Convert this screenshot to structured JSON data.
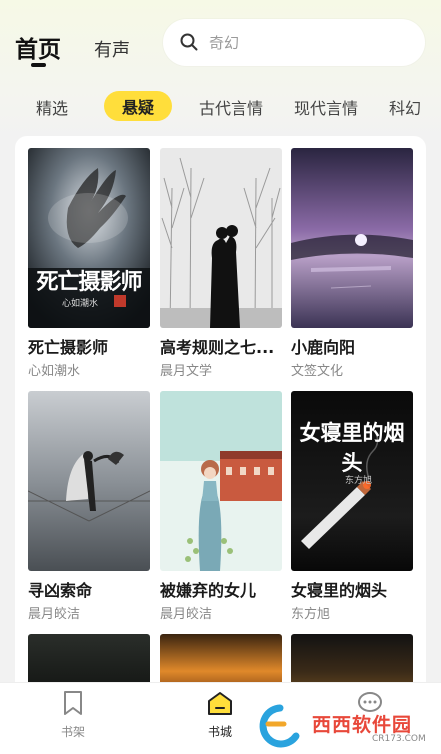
{
  "header": {
    "tabs": [
      {
        "label": "首页"
      },
      {
        "label": "有声"
      }
    ],
    "search": {
      "placeholder": "奇幻"
    }
  },
  "categories": [
    {
      "label": "精选"
    },
    {
      "label": "悬疑"
    },
    {
      "label": "古代言情"
    },
    {
      "label": "现代言情"
    },
    {
      "label": "科幻"
    }
  ],
  "books": [
    {
      "title": "死亡摄影师",
      "author": "心如潮水",
      "cover_title": "死亡摄影师",
      "cover_author": "心如潮水"
    },
    {
      "title": "高考规则之七...",
      "author": "晨月文学"
    },
    {
      "title": "小鹿向阳",
      "author": "文签文化"
    },
    {
      "title": "寻凶索命",
      "author": "晨月皎洁"
    },
    {
      "title": "被嫌弃的女儿",
      "author": "晨月皎洁"
    },
    {
      "title": "女寝里的烟头",
      "author": "东方旭",
      "cover_title": "女寝里的烟头",
      "cover_author": "东方旭"
    }
  ],
  "bottom_nav": [
    {
      "label": "书架",
      "icon": "bookmark-icon"
    },
    {
      "label": "书城",
      "icon": "home-icon"
    }
  ],
  "watermark": {
    "text": "西西软件园",
    "domain": "CR173.COM"
  },
  "colors": {
    "accent": "#ffde3b"
  }
}
